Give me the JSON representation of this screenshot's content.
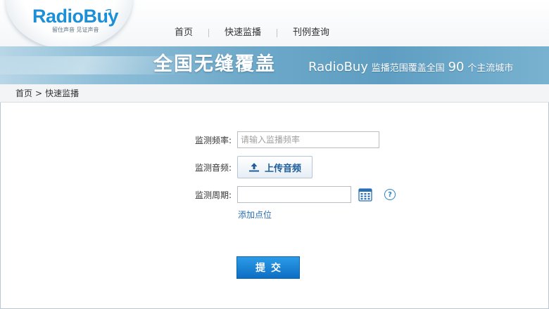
{
  "logo": {
    "text": "RadioBuy",
    "tagline": "留住声音 见证声音",
    "brand_color": "#1c8fd6"
  },
  "nav": {
    "items": [
      {
        "label": "首页"
      },
      {
        "label": "快速监播"
      },
      {
        "label": "刊例查询"
      }
    ]
  },
  "banner": {
    "title": "全国无缝覆盖",
    "brand": "RadioBuy",
    "desc_prefix": "监播范围覆盖全国",
    "count": "90",
    "desc_suffix": "个主流城市"
  },
  "breadcrumb": {
    "home": "首页",
    "separator": ">",
    "current": "快速监播"
  },
  "form": {
    "frequency_label": "监测频率:",
    "frequency_value": "",
    "frequency_placeholder": "请输入监播频率",
    "audio_label": "监测音频:",
    "upload_label": "上传音频",
    "period_label": "监测周期:",
    "period_value": "",
    "help_text": "?",
    "add_point_label": "添加点位",
    "submit_label": "提交"
  },
  "icons": {
    "upload": "upload-icon",
    "calendar": "calendar-icon",
    "help": "question-icon"
  },
  "colors": {
    "accent": "#1a7fd0",
    "link": "#2a6fb4",
    "banner": "#6ea9c9"
  }
}
